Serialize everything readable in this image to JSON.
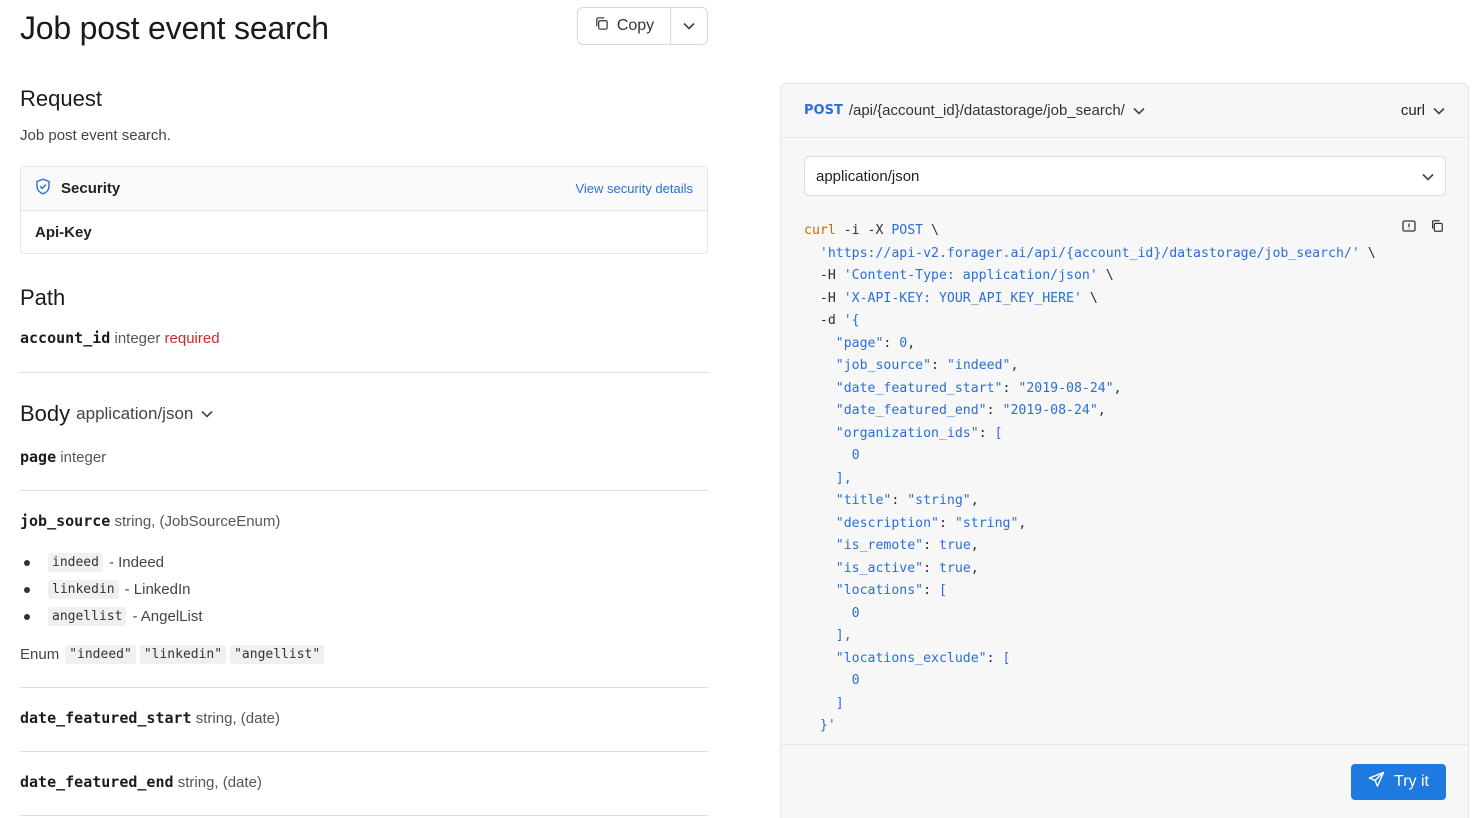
{
  "page": {
    "title": "Job post event search",
    "copy_label": "Copy"
  },
  "request": {
    "heading": "Request",
    "description": "Job post event search.",
    "security": {
      "title": "Security",
      "link": "View security details",
      "scheme": "Api-Key"
    }
  },
  "path": {
    "heading": "Path",
    "params": [
      {
        "name": "account_id",
        "type": "integer",
        "required": "required"
      }
    ]
  },
  "body": {
    "heading": "Body",
    "content_type": "application/json",
    "params": [
      {
        "name": "page",
        "type": "integer"
      },
      {
        "name": "job_source",
        "type": "string, (JobSourceEnum)"
      },
      {
        "name": "date_featured_start",
        "type": "string, (date)"
      },
      {
        "name": "date_featured_end",
        "type": "string, (date)"
      }
    ],
    "job_source_enum": [
      {
        "code": "indeed",
        "label": "- Indeed"
      },
      {
        "code": "linkedin",
        "label": "- LinkedIn"
      },
      {
        "code": "angellist",
        "label": "- AngelList"
      }
    ],
    "enum_label": "Enum",
    "enum_values": [
      "\"indeed\"",
      "\"linkedin\"",
      "\"angellist\""
    ]
  },
  "panel": {
    "method": "POST",
    "endpoint": "/api/{account_id}/datastorage/job_search/",
    "language": "curl",
    "content_type": "application/json",
    "try_label": "Try it",
    "code_lines": [
      [
        [
          "cmd",
          "curl"
        ],
        [
          "flag",
          " -i -X "
        ],
        [
          "str",
          "POST"
        ],
        [
          "plain",
          " \\"
        ]
      ],
      [
        [
          "plain",
          "  "
        ],
        [
          "str",
          "'https://api-v2.forager.ai/api/{account_id}/datastorage/job_search/'"
        ],
        [
          "plain",
          " \\"
        ]
      ],
      [
        [
          "flag",
          "  -H "
        ],
        [
          "str",
          "'Content-Type: application/json'"
        ],
        [
          "plain",
          " \\"
        ]
      ],
      [
        [
          "flag",
          "  -H "
        ],
        [
          "str",
          "'X-API-KEY: YOUR_API_KEY_HERE'"
        ],
        [
          "plain",
          " \\"
        ]
      ],
      [
        [
          "flag",
          "  -d "
        ],
        [
          "str",
          "'{"
        ]
      ],
      [
        [
          "plain",
          "    "
        ],
        [
          "key",
          "\"page\""
        ],
        [
          "plain",
          ": "
        ],
        [
          "num",
          "0"
        ],
        [
          "plain",
          ","
        ]
      ],
      [
        [
          "plain",
          "    "
        ],
        [
          "key",
          "\"job_source\""
        ],
        [
          "plain",
          ": "
        ],
        [
          "str",
          "\"indeed\""
        ],
        [
          "plain",
          ","
        ]
      ],
      [
        [
          "plain",
          "    "
        ],
        [
          "key",
          "\"date_featured_start\""
        ],
        [
          "plain",
          ": "
        ],
        [
          "str",
          "\"2019-08-24\""
        ],
        [
          "plain",
          ","
        ]
      ],
      [
        [
          "plain",
          "    "
        ],
        [
          "key",
          "\"date_featured_end\""
        ],
        [
          "plain",
          ": "
        ],
        [
          "str",
          "\"2019-08-24\""
        ],
        [
          "plain",
          ","
        ]
      ],
      [
        [
          "plain",
          "    "
        ],
        [
          "key",
          "\"organization_ids\""
        ],
        [
          "plain",
          ": "
        ],
        [
          "str",
          "["
        ]
      ],
      [
        [
          "plain",
          "      "
        ],
        [
          "num",
          "0"
        ]
      ],
      [
        [
          "plain",
          "    "
        ],
        [
          "str",
          "],"
        ]
      ],
      [
        [
          "plain",
          "    "
        ],
        [
          "key",
          "\"title\""
        ],
        [
          "plain",
          ": "
        ],
        [
          "str",
          "\"string\""
        ],
        [
          "plain",
          ","
        ]
      ],
      [
        [
          "plain",
          "    "
        ],
        [
          "key",
          "\"description\""
        ],
        [
          "plain",
          ": "
        ],
        [
          "str",
          "\"string\""
        ],
        [
          "plain",
          ","
        ]
      ],
      [
        [
          "plain",
          "    "
        ],
        [
          "key",
          "\"is_remote\""
        ],
        [
          "plain",
          ": "
        ],
        [
          "num",
          "true"
        ],
        [
          "plain",
          ","
        ]
      ],
      [
        [
          "plain",
          "    "
        ],
        [
          "key",
          "\"is_active\""
        ],
        [
          "plain",
          ": "
        ],
        [
          "num",
          "true"
        ],
        [
          "plain",
          ","
        ]
      ],
      [
        [
          "plain",
          "    "
        ],
        [
          "key",
          "\"locations\""
        ],
        [
          "plain",
          ": "
        ],
        [
          "str",
          "["
        ]
      ],
      [
        [
          "plain",
          "      "
        ],
        [
          "num",
          "0"
        ]
      ],
      [
        [
          "plain",
          "    "
        ],
        [
          "str",
          "],"
        ]
      ],
      [
        [
          "plain",
          "    "
        ],
        [
          "key",
          "\"locations_exclude\""
        ],
        [
          "plain",
          ": "
        ],
        [
          "str",
          "["
        ]
      ],
      [
        [
          "plain",
          "      "
        ],
        [
          "num",
          "0"
        ]
      ],
      [
        [
          "plain",
          "    "
        ],
        [
          "str",
          "]"
        ]
      ],
      [
        [
          "plain",
          "  "
        ],
        [
          "str",
          "}'"
        ]
      ]
    ]
  }
}
